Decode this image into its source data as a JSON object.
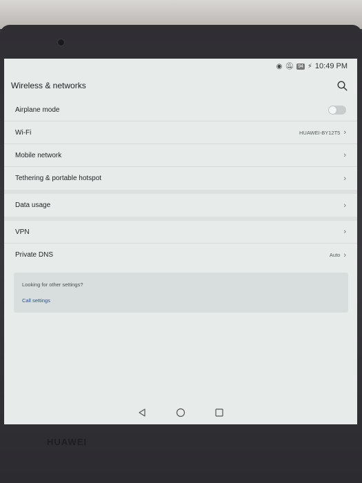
{
  "status_bar": {
    "icons": [
      "eye-icon",
      "mute-icon"
    ],
    "battery": "94",
    "time": "10:49 PM"
  },
  "header": {
    "title": "Wireless & networks",
    "search_icon": "search-icon"
  },
  "rows": {
    "airplane": {
      "label": "Airplane mode",
      "enabled": false
    },
    "wifi": {
      "label": "Wi-Fi",
      "value": "HUAWEI-BY12T5"
    },
    "mobile": {
      "label": "Mobile network"
    },
    "tethering": {
      "label": "Tethering & portable hotspot"
    },
    "data_usage": {
      "label": "Data usage"
    },
    "vpn": {
      "label": "VPN"
    },
    "dns": {
      "label": "Private DNS",
      "value": "Auto"
    }
  },
  "card": {
    "text": "Looking for other settings?",
    "link": "Call settings"
  },
  "navbar": [
    "back-icon",
    "home-icon",
    "recents-icon"
  ],
  "device": {
    "brand": "HUAWEI"
  },
  "colors": {
    "screen_bg": "#e7ecea",
    "link": "#2c4f8e",
    "bezel": "#333237"
  }
}
